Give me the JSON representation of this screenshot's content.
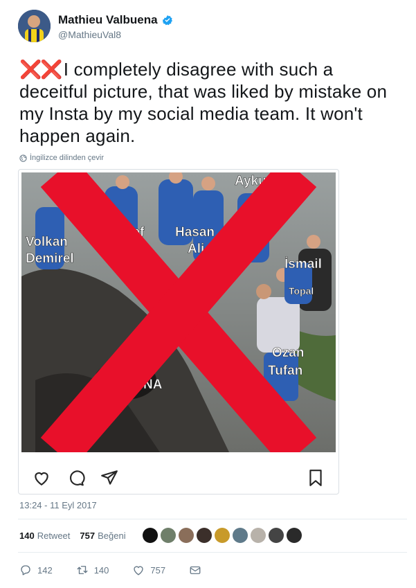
{
  "author": {
    "display_name": "Mathieu Valbuena",
    "handle": "@MathieuVal8",
    "verified": true
  },
  "tweet": {
    "prefix_icons": "❌❌",
    "text": "I completely disagree with such a deceitful picture, that was liked by mistake on my Insta by my social media team. It won't happen again.",
    "translate_label": "İngilizce dilinden çevir",
    "timestamp": "13:24 - 11 Eyl 2017"
  },
  "media": {
    "photo_labels": [
      "Aykut",
      "Volkan",
      "Demirel",
      "sef",
      "Hasan",
      "Ali",
      "İsmail",
      "Topal",
      "Ozan",
      "Tufan",
      "NA"
    ],
    "overlay_mark": "big-red-x",
    "insta_icons": [
      "heart-icon",
      "comment-icon",
      "send-icon",
      "bookmark-icon"
    ]
  },
  "stats": {
    "retweets_count": "140",
    "retweets_label": "Retweet",
    "likes_count": "757",
    "likes_label": "Beğeni"
  },
  "likers": {
    "colors": [
      "#111111",
      "#6f7f6a",
      "#8a6e5a",
      "#3b2f2a",
      "#c89a2a",
      "#5f7a8a",
      "#b8b2aa",
      "#444444",
      "#2a2a2a"
    ]
  },
  "actions": {
    "reply_count": "142",
    "retweet_count": "140",
    "like_count": "757"
  },
  "colors": {
    "verified_blue": "#1da1f2",
    "muted_text": "#657786",
    "red_x": "#e8102a"
  }
}
